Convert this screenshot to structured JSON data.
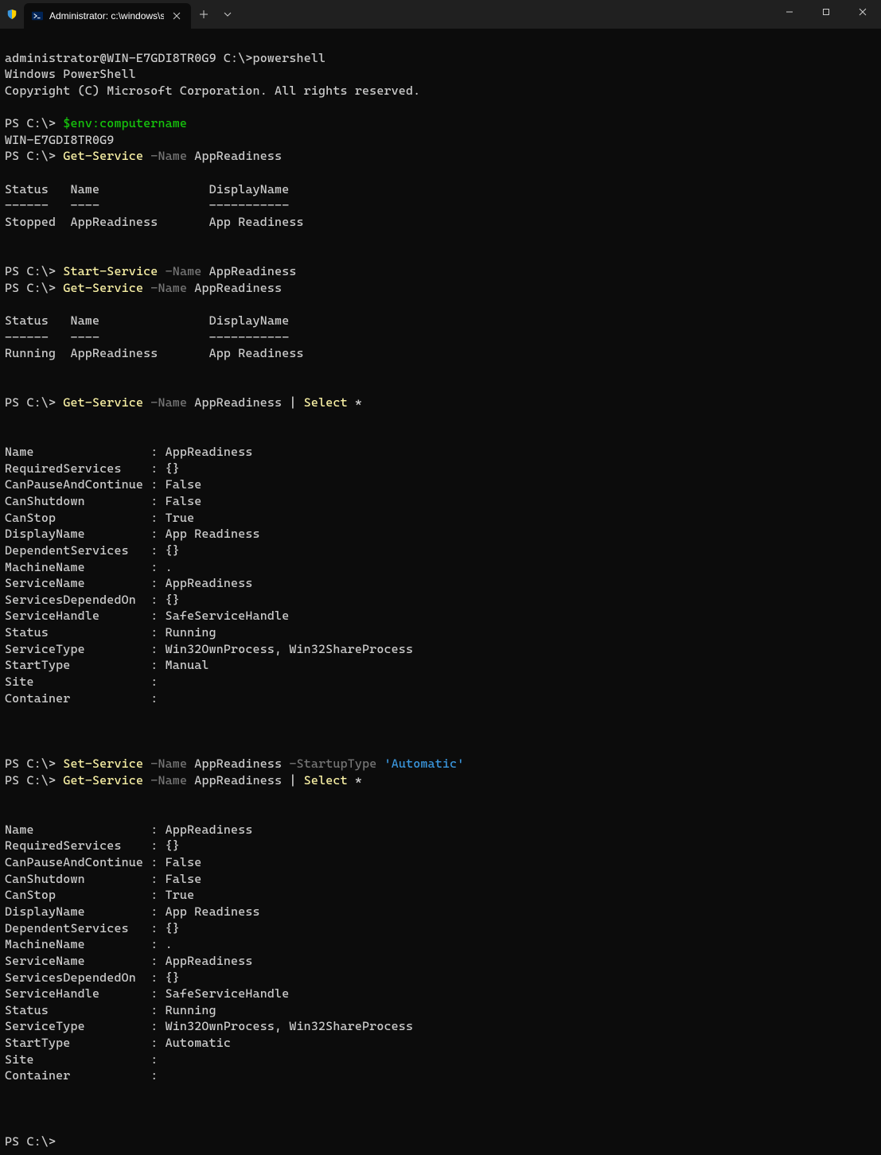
{
  "window": {
    "tab_title": "Administrator: c:\\windows\\sy"
  },
  "session": {
    "initial_prompt": "administrator@WIN-E7GDI8TR0G9 C:\\>",
    "initial_cmd": "powershell",
    "banner_line1": "Windows PowerShell",
    "banner_line2": "Copyright (C) Microsoft Corporation. All rights reserved.",
    "ps_prompt": "PS C:\\>",
    "cmd1": "$env:computername",
    "out1": "WIN-E7GDI8TR0G9",
    "cmds": {
      "get_service": "Get-Service",
      "start_service": "Start-Service",
      "set_service": "Set-Service",
      "select": "Select"
    },
    "params": {
      "name": "-Name",
      "startuptype": "-StartupType"
    },
    "args": {
      "appreadiness": "AppReadiness",
      "pipe": " | ",
      "star": " *",
      "automatic": "'Automatic'"
    },
    "table_header": "Status   Name               DisplayName",
    "table_divider": "------   ----               -----------",
    "table_stopped": "Stopped  AppReadiness       App Readiness",
    "table_running": "Running  AppReadiness       App Readiness",
    "detail_manual": [
      "Name                : AppReadiness",
      "RequiredServices    : {}",
      "CanPauseAndContinue : False",
      "CanShutdown         : False",
      "CanStop             : True",
      "DisplayName         : App Readiness",
      "DependentServices   : {}",
      "MachineName         : .",
      "ServiceName         : AppReadiness",
      "ServicesDependedOn  : {}",
      "ServiceHandle       : SafeServiceHandle",
      "Status              : Running",
      "ServiceType         : Win32OwnProcess, Win32ShareProcess",
      "StartType           : Manual",
      "Site                :",
      "Container           :"
    ],
    "detail_auto": [
      "Name                : AppReadiness",
      "RequiredServices    : {}",
      "CanPauseAndContinue : False",
      "CanShutdown         : False",
      "CanStop             : True",
      "DisplayName         : App Readiness",
      "DependentServices   : {}",
      "MachineName         : .",
      "ServiceName         : AppReadiness",
      "ServicesDependedOn  : {}",
      "ServiceHandle       : SafeServiceHandle",
      "Status              : Running",
      "ServiceType         : Win32OwnProcess, Win32ShareProcess",
      "StartType           : Automatic",
      "Site                :",
      "Container           :"
    ]
  }
}
